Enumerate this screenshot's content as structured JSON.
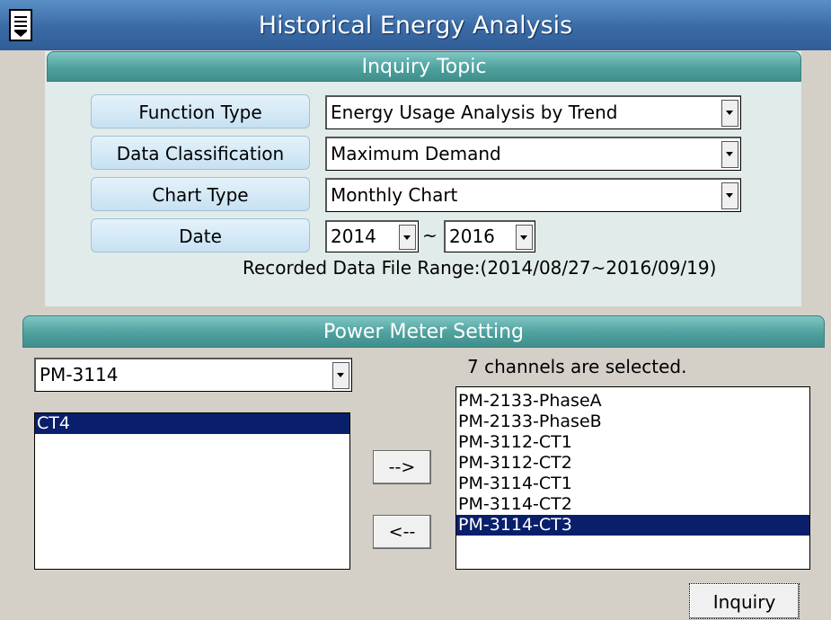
{
  "header": {
    "title": "Historical Energy Analysis",
    "menu_icon": "menu-icon"
  },
  "inquiry_topic": {
    "title": "Inquiry Topic",
    "function_type": {
      "label": "Function Type",
      "value": "Energy Usage Analysis by Trend"
    },
    "data_classification": {
      "label": "Data Classification",
      "value": "Maximum Demand"
    },
    "chart_type": {
      "label": "Chart Type",
      "value": "Monthly Chart"
    },
    "date": {
      "label": "Date",
      "from": "2014",
      "separator": "~",
      "to": "2016"
    },
    "range_text": "Recorded Data File Range:(2014/08/27~2016/09/19)"
  },
  "power_meter": {
    "title": "Power Meter Setting",
    "meter_select": "PM-3114",
    "available_channels": [
      {
        "label": "CT4",
        "selected": true
      }
    ],
    "selected_count_text": "7 channels are selected.",
    "selected_channels": [
      {
        "label": "PM-2133-PhaseA",
        "selected": false
      },
      {
        "label": "PM-2133-PhaseB",
        "selected": false
      },
      {
        "label": "PM-3112-CT1",
        "selected": false
      },
      {
        "label": "PM-3112-CT2",
        "selected": false
      },
      {
        "label": "PM-3114-CT1",
        "selected": false
      },
      {
        "label": "PM-3114-CT2",
        "selected": false
      },
      {
        "label": "PM-3114-CT3",
        "selected": true
      }
    ],
    "add_button": "-->",
    "remove_button": "<--"
  },
  "inquiry_button": "Inquiry",
  "colors": {
    "title_bar": "#3a6aa5",
    "section_header": "#4ea19e",
    "panel_bg": "#e1ebe9",
    "selection": "#0a1f6b"
  }
}
